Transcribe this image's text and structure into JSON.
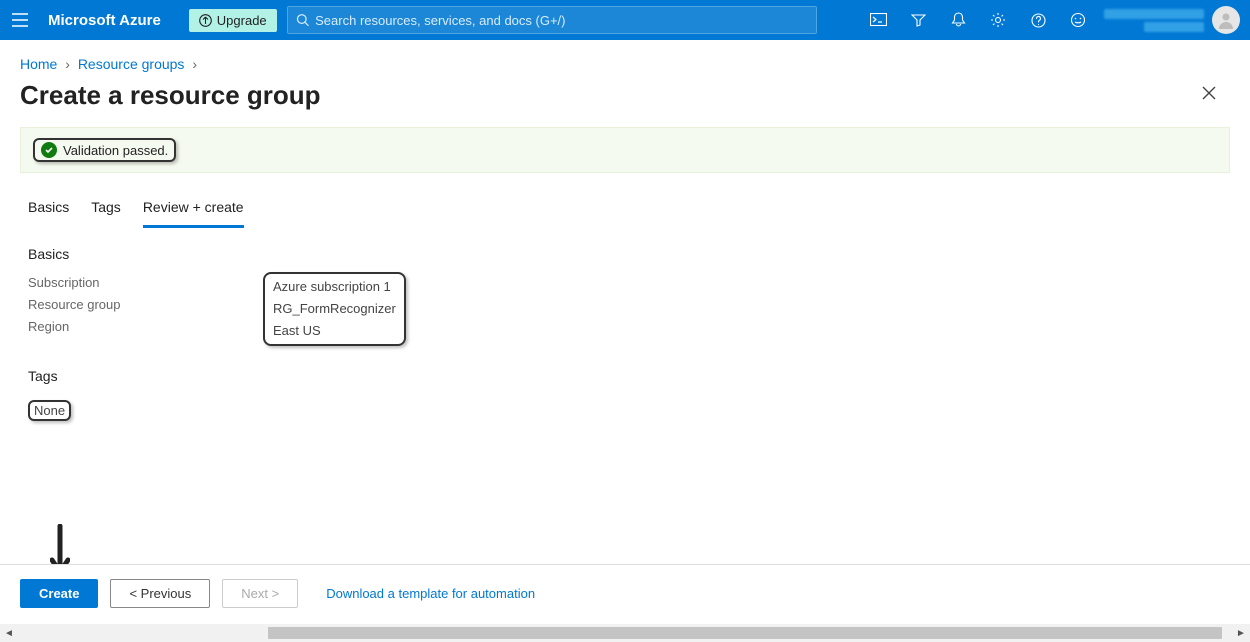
{
  "header": {
    "brand": "Microsoft Azure",
    "upgrade_label": "Upgrade",
    "search_placeholder": "Search resources, services, and docs (G+/)"
  },
  "breadcrumb": {
    "home": "Home",
    "resource_groups": "Resource groups"
  },
  "page": {
    "title": "Create a resource group"
  },
  "validation": {
    "message": "Validation passed."
  },
  "tabs": {
    "basics": "Basics",
    "tags": "Tags",
    "review_create": "Review + create"
  },
  "sections": {
    "basics_title": "Basics",
    "tags_title": "Tags"
  },
  "basics": {
    "subscription_label": "Subscription",
    "subscription_value": "Azure subscription 1",
    "rg_label": "Resource group",
    "rg_value": "RG_FormRecognizer",
    "region_label": "Region",
    "region_value": "East US"
  },
  "tags": {
    "none": "None"
  },
  "footer": {
    "create": "Create",
    "previous": "<  Previous",
    "next": "Next  >",
    "download_link": "Download a template for automation"
  }
}
